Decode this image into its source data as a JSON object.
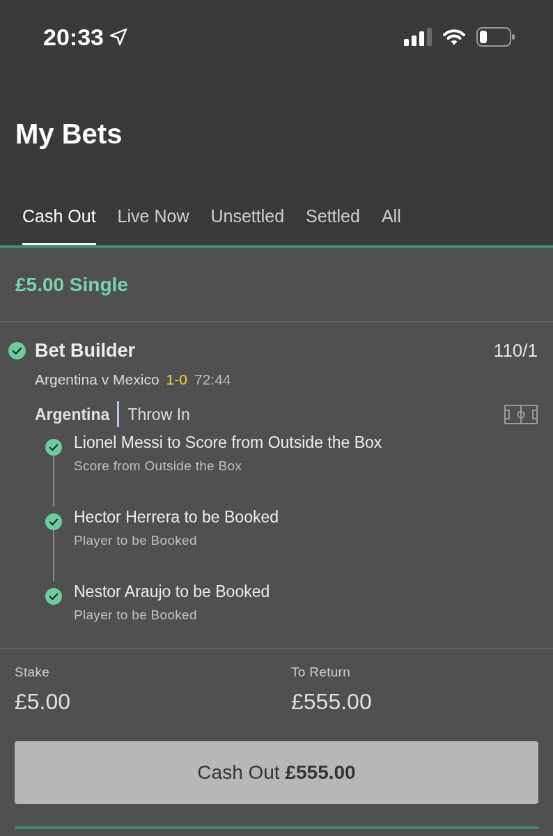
{
  "status_bar": {
    "time": "20:33"
  },
  "header": {
    "title": "My Bets"
  },
  "tabs": [
    {
      "label": "Cash Out",
      "selected": true
    },
    {
      "label": "Live Now",
      "selected": false
    },
    {
      "label": "Unsettled",
      "selected": false
    },
    {
      "label": "Settled",
      "selected": false
    },
    {
      "label": "All",
      "selected": false
    }
  ],
  "bet": {
    "heading": "£5.00 Single",
    "title": "Bet Builder",
    "checked": true,
    "odds": "110/1",
    "match": "Argentina v Mexico",
    "score": "1-0",
    "clock": "72:44",
    "team": "Argentina",
    "live_event": "Throw In",
    "legs": [
      {
        "title": "Lionel Messi to Score from Outside the Box",
        "market": "Score from Outside the Box",
        "checked": true
      },
      {
        "title": "Hector Herrera to be Booked",
        "market": "Player to be Booked",
        "checked": true
      },
      {
        "title": "Nestor Araujo to be Booked",
        "market": "Player to be Booked",
        "checked": true
      }
    ],
    "stake_label": "Stake",
    "stake": "£5.00",
    "return_label": "To Return",
    "return_value": "£555.00",
    "cash_out": {
      "label": "Cash Out",
      "amount": "£555.00"
    }
  }
}
